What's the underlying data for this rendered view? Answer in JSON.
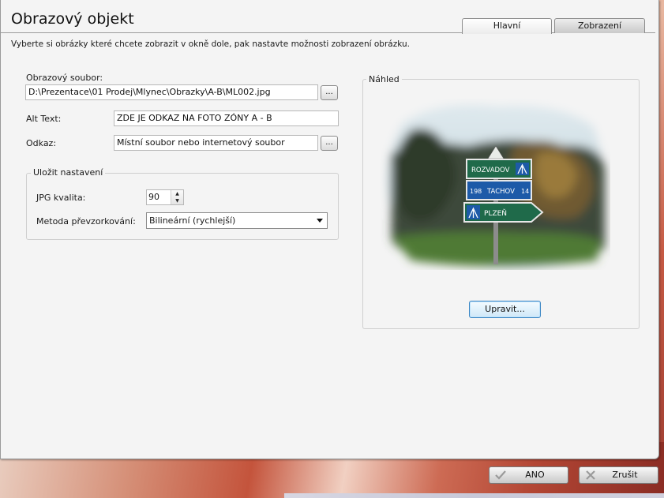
{
  "dialog": {
    "title": "Obrazový objekt",
    "instructions": "Vyberte si obrázky které chcete zobrazit v okně dole, pak nastavte možnosti zobrazení obrázku."
  },
  "tabs": [
    {
      "label": "Hlavní",
      "active": true
    },
    {
      "label": "Zobrazení",
      "active": false
    }
  ],
  "form": {
    "image_file_label": "Obrazový soubor:",
    "image_file_value": "D:\\Prezentace\\01 Prodej\\Mlynec\\Obrazky\\A-B\\ML002.jpg",
    "browse_label": "...",
    "alt_text_label": "Alt Text:",
    "alt_text_value": "ZDE JE ODKAZ NA FOTO ZÓNY A - B",
    "link_label": "Odkaz:",
    "link_value": "Místní soubor nebo internetový soubor",
    "link_browse_label": "..."
  },
  "save_settings": {
    "legend": "Uložit nastavení",
    "jpg_quality_label": "JPG kvalita:",
    "jpg_quality_value": "90",
    "resample_label": "Metoda převzorkování:",
    "resample_value": "Bilineární (rychlejší)"
  },
  "preview": {
    "legend": "Náhled",
    "edit_button": "Upravit...",
    "signs": {
      "top": "ROZVADOV",
      "middle_number": "198",
      "middle_city": "TACHOV",
      "middle_distance": "14",
      "bottom": "PLZEŇ"
    }
  },
  "footer": {
    "ok_label": "ANO",
    "cancel_label": "Zrušit"
  },
  "colors": {
    "accent_blue": "#3b86c4",
    "sign_green": "#1f6a4a",
    "sign_blue": "#1d5aa8"
  }
}
